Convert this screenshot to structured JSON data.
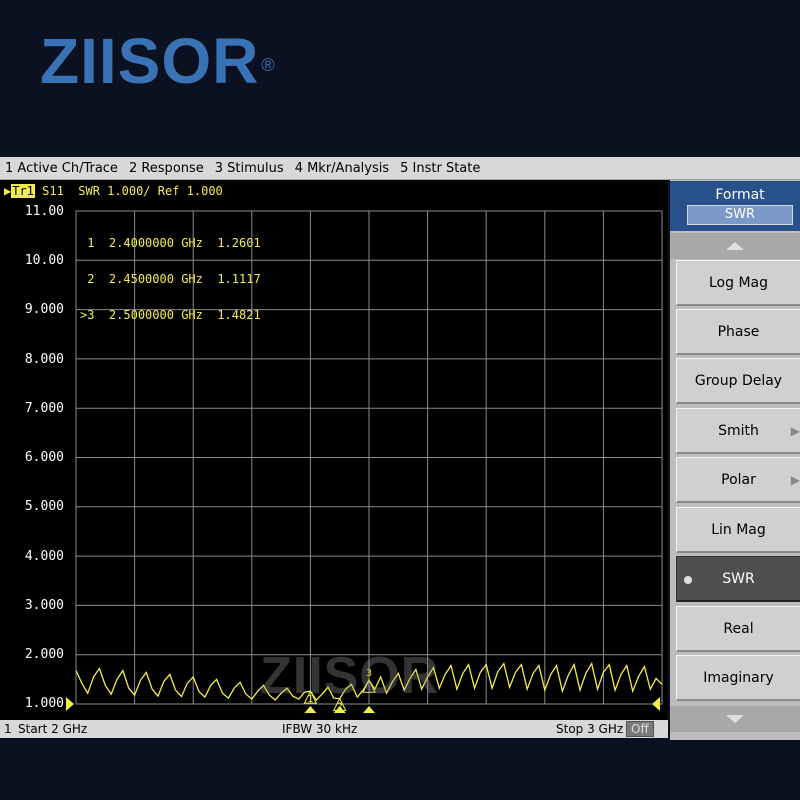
{
  "logo": {
    "text": "ZIISOR",
    "mark": "®"
  },
  "menubar": [
    "1 Active Ch/Trace",
    "2 Response",
    "3 Stimulus",
    "4 Mkr/Analysis",
    "5 Instr State"
  ],
  "trace_header": {
    "tag": "Tr1",
    "text": "S11  SWR 1.000/ Ref 1.000"
  },
  "yaxis": {
    "labels": [
      "11.00",
      "10.00",
      "9.000",
      "8.000",
      "7.000",
      "6.000",
      "5.000",
      "4.000",
      "3.000",
      "2.000",
      "1.000"
    ],
    "min": 1.0,
    "max": 11.0
  },
  "markers": [
    {
      "prefix": " ",
      "id": "1",
      "freq": "2.4000000",
      "unit": "GHz",
      "value": "1.2601"
    },
    {
      "prefix": " ",
      "id": "2",
      "freq": "2.4500000",
      "unit": "GHz",
      "value": "1.1117"
    },
    {
      "prefix": ">",
      "id": "3",
      "freq": "2.5000000",
      "unit": "GHz",
      "value": "1.4821"
    }
  ],
  "watermark": "ZIISOR",
  "status": {
    "channel": "1",
    "start": "Start 2 GHz",
    "ifbw": "IFBW 30 kHz",
    "stop": "Stop 3 GHz",
    "off": "Off"
  },
  "panel": {
    "title": "Format",
    "value": "SWR",
    "keys": [
      "Log Mag",
      "Phase",
      "Group Delay",
      "Smith",
      "Polar",
      "Lin Mag",
      "SWR",
      "Real",
      "Imaginary"
    ],
    "selected": "SWR"
  },
  "colors": {
    "trace": "#f3ee47",
    "grid": "#8c8c8c",
    "panel_header": "#28508a",
    "logo": "#3a73b5"
  },
  "chart_data": {
    "type": "line",
    "ylabel": "",
    "xlabel": "",
    "xlim": [
      2.0,
      3.0
    ],
    "ylim": [
      1.0,
      11.0
    ],
    "grid": true,
    "series": [
      {
        "x": [
          2.0,
          2.01,
          2.02,
          2.03,
          2.04,
          2.05,
          2.06,
          2.07,
          2.08,
          2.09,
          2.1,
          2.11,
          2.12,
          2.13,
          2.14,
          2.15,
          2.16,
          2.17,
          2.18,
          2.19,
          2.2,
          2.21,
          2.22,
          2.23,
          2.24,
          2.25,
          2.26,
          2.27,
          2.28,
          2.29,
          2.3,
          2.31,
          2.32,
          2.33,
          2.34,
          2.35,
          2.36,
          2.37,
          2.38,
          2.39,
          2.4,
          2.41,
          2.42,
          2.43,
          2.44,
          2.45,
          2.46,
          2.47,
          2.48,
          2.49,
          2.5,
          2.51,
          2.52,
          2.53,
          2.54,
          2.55,
          2.56,
          2.57,
          2.58,
          2.59,
          2.6,
          2.61,
          2.62,
          2.63,
          2.64,
          2.65,
          2.66,
          2.67,
          2.68,
          2.69,
          2.7,
          2.71,
          2.72,
          2.73,
          2.74,
          2.75,
          2.76,
          2.77,
          2.78,
          2.79,
          2.8,
          2.81,
          2.82,
          2.83,
          2.84,
          2.85,
          2.86,
          2.87,
          2.88,
          2.89,
          2.9,
          2.91,
          2.92,
          2.93,
          2.94,
          2.95,
          2.96,
          2.97,
          2.98,
          2.99,
          3.0
        ],
        "y": [
          1.68,
          1.42,
          1.22,
          1.55,
          1.72,
          1.38,
          1.2,
          1.5,
          1.68,
          1.32,
          1.18,
          1.48,
          1.64,
          1.3,
          1.16,
          1.46,
          1.6,
          1.28,
          1.15,
          1.42,
          1.55,
          1.25,
          1.14,
          1.38,
          1.5,
          1.22,
          1.12,
          1.32,
          1.44,
          1.2,
          1.1,
          1.26,
          1.38,
          1.18,
          1.08,
          1.22,
          1.32,
          1.16,
          1.1,
          1.24,
          1.26,
          1.08,
          1.2,
          1.34,
          1.12,
          1.11,
          1.3,
          1.4,
          1.14,
          1.28,
          1.48,
          1.3,
          1.55,
          1.22,
          1.45,
          1.62,
          1.28,
          1.52,
          1.7,
          1.3,
          1.55,
          1.74,
          1.32,
          1.6,
          1.78,
          1.3,
          1.62,
          1.8,
          1.32,
          1.64,
          1.8,
          1.32,
          1.66,
          1.82,
          1.34,
          1.64,
          1.8,
          1.3,
          1.62,
          1.78,
          1.28,
          1.6,
          1.78,
          1.26,
          1.58,
          1.8,
          1.28,
          1.62,
          1.82,
          1.3,
          1.64,
          1.8,
          1.28,
          1.6,
          1.78,
          1.26,
          1.56,
          1.76,
          1.3,
          1.52,
          1.4
        ]
      }
    ],
    "marker_points": [
      {
        "id": "1",
        "x": 2.4,
        "y": 1.2601
      },
      {
        "id": "2",
        "x": 2.45,
        "y": 1.1117
      },
      {
        "id": "3",
        "x": 2.5,
        "y": 1.4821
      }
    ]
  }
}
